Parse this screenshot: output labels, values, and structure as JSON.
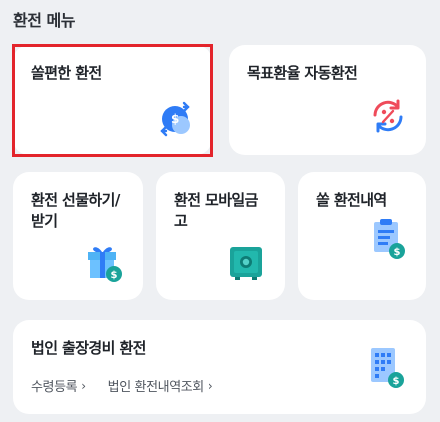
{
  "section": {
    "title": "환전 메뉴"
  },
  "cards": {
    "easy_exchange": {
      "label": "쏠편한 환전",
      "icon": "currency-exchange-icon"
    },
    "target_rate": {
      "label": "목표환율 자동환전",
      "icon": "auto-rate-icon"
    },
    "gift": {
      "label": "환전 선물하기/\n받기",
      "icon": "gift-icon"
    },
    "mobile_safe": {
      "label": "환전 모바일금\n고",
      "icon": "safe-icon"
    },
    "history": {
      "label": "쏠 환전내역",
      "icon": "receipt-icon"
    },
    "corporate": {
      "label": "법인 출장경비 환전",
      "icon": "building-icon",
      "links": [
        {
          "label": "수령등록",
          "chevron": "›"
        },
        {
          "label": "법인 환전내역조회",
          "chevron": "›"
        }
      ]
    }
  },
  "colors": {
    "highlight": "#e3242b",
    "accent_blue": "#2f7cf6",
    "accent_light_blue": "#9cc8ff",
    "accent_red": "#ef4b5a",
    "accent_green": "#1aa39a"
  }
}
